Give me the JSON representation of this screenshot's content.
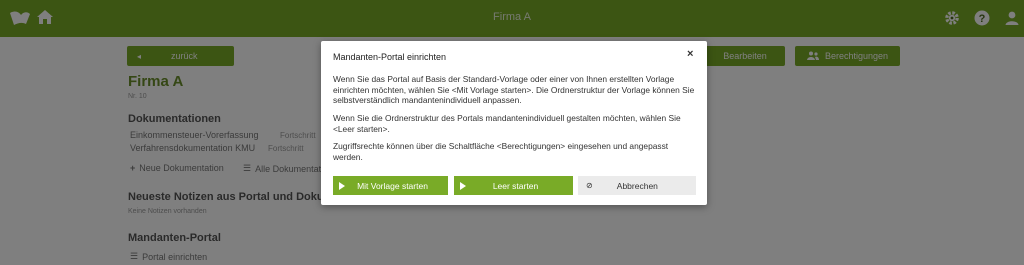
{
  "app": {
    "title": "Firma A"
  },
  "page": {
    "back_label": "zurück",
    "edit_label": "Bearbeiten",
    "permissions_label": "Berechtigungen",
    "company_name": "Firma A",
    "company_nr": "Nr. 10",
    "docs_heading": "Dokumentationen",
    "docs": [
      {
        "name": "Einkommensteuer-Vorerfassung",
        "status": "Fortschritt"
      },
      {
        "name": "Verfahrensdokumentation KMU",
        "status": "Fortschritt"
      }
    ],
    "new_doc_label": "Neue Dokumentation",
    "all_docs_label": "Alle Dokumentati",
    "notes_heading": "Neueste Notizen aus Portal und Doku",
    "notes_empty": "Keine Notizen vorhanden",
    "portal_heading": "Mandanten-Portal",
    "portal_setup_label": "Portal einrichten"
  },
  "modal": {
    "title": "Mandanten-Portal einrichten",
    "close_symbol": "×",
    "paragraph1": "Wenn Sie das Portal auf Basis der Standard-Vorlage oder einer von Ihnen erstellten Vorlage einrichten möchten, wählen Sie <Mit Vorlage starten>. Die Ordnerstruktur der Vorlage können Sie selbstverständlich mandantenindividuell anpassen.",
    "paragraph2": "Wenn Sie die Ordnerstruktur des Portals mandantenindividuell gestalten möchten, wählen Sie <Leer starten>.",
    "paragraph3": "Zugriffsrechte können über die Schaltfläche <Berechtigungen> eingesehen und angepasst werden.",
    "btn_template": "Mit Vorlage starten",
    "btn_empty": "Leer starten",
    "btn_cancel": "Abbrechen"
  },
  "colors": {
    "brand_green": "#79ab27",
    "heading_green": "#6a8f2a"
  },
  "icons": [
    "logo-icon",
    "home-icon",
    "gear-icon",
    "help-icon",
    "user-icon",
    "play-icon",
    "cancel-icon",
    "plus-icon",
    "list-icon"
  ]
}
